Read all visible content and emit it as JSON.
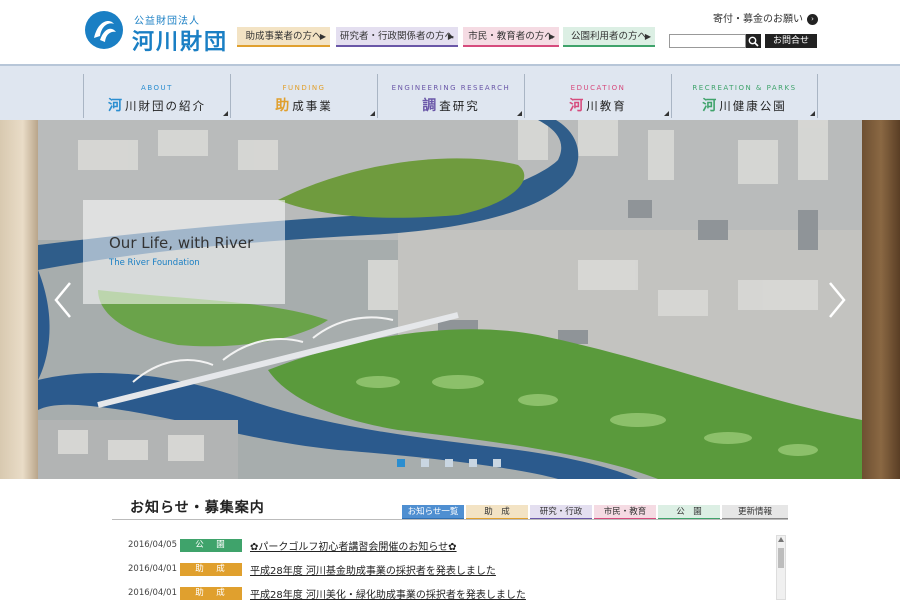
{
  "header": {
    "logo_small": "公益財団法人",
    "logo_big": "河川財団",
    "audience_links": [
      {
        "label": "助成事業者の方へ"
      },
      {
        "label": "研究者・行政関係者の方へ"
      },
      {
        "label": "市民・教育者の方へ"
      },
      {
        "label": "公園利用者の方へ"
      }
    ],
    "audience_arrow": "▶",
    "donation": "寄付・募金のお願い",
    "donation_arrow": "›",
    "contact": "お問合せ",
    "search_value": "",
    "icons": {
      "logo": "logo-mark-icon",
      "search": "search-icon"
    }
  },
  "nav": [
    {
      "en": "ABOUT",
      "first": "河",
      "rest": "川財団の紹介",
      "color": "#2b8ed0"
    },
    {
      "en": "FUNDING",
      "first": "助",
      "rest": "成事業",
      "color": "#e0a02e"
    },
    {
      "en": "ENGINEERING RESEARCH",
      "first": "調",
      "rest": "査研究",
      "color": "#6a57a8"
    },
    {
      "en": "EDUCATION",
      "first": "河",
      "rest": "川教育",
      "color": "#d64b7d"
    },
    {
      "en": "RECREATION & PARKS",
      "first": "河",
      "rest": "川健康公園",
      "color": "#3fa36b"
    }
  ],
  "hero": {
    "caption_main": "Our Life, with River",
    "caption_sub": "The River Foundation",
    "slide_count": 5,
    "active_slide": 1
  },
  "news": {
    "title": "お知らせ・募集案内",
    "tabs": [
      "お知らせ一覧",
      "助　成",
      "研究・行政",
      "市民・教育",
      "公　園",
      "更新情報"
    ],
    "items": [
      {
        "date": "2016/04/05",
        "category": "公　園",
        "category_color": "#3fa36b",
        "title": "✿パークゴルフ初心者講習会開催のお知らせ✿"
      },
      {
        "date": "2016/04/01",
        "category": "助　成",
        "category_color": "#e0a02e",
        "title": "平成28年度 河川基金助成事業の採択者を発表しました"
      },
      {
        "date": "2016/04/01",
        "category": "助　成",
        "category_color": "#e0a02e",
        "title": "平成28年度 河川美化・緑化助成事業の採択者を発表しました"
      }
    ]
  }
}
